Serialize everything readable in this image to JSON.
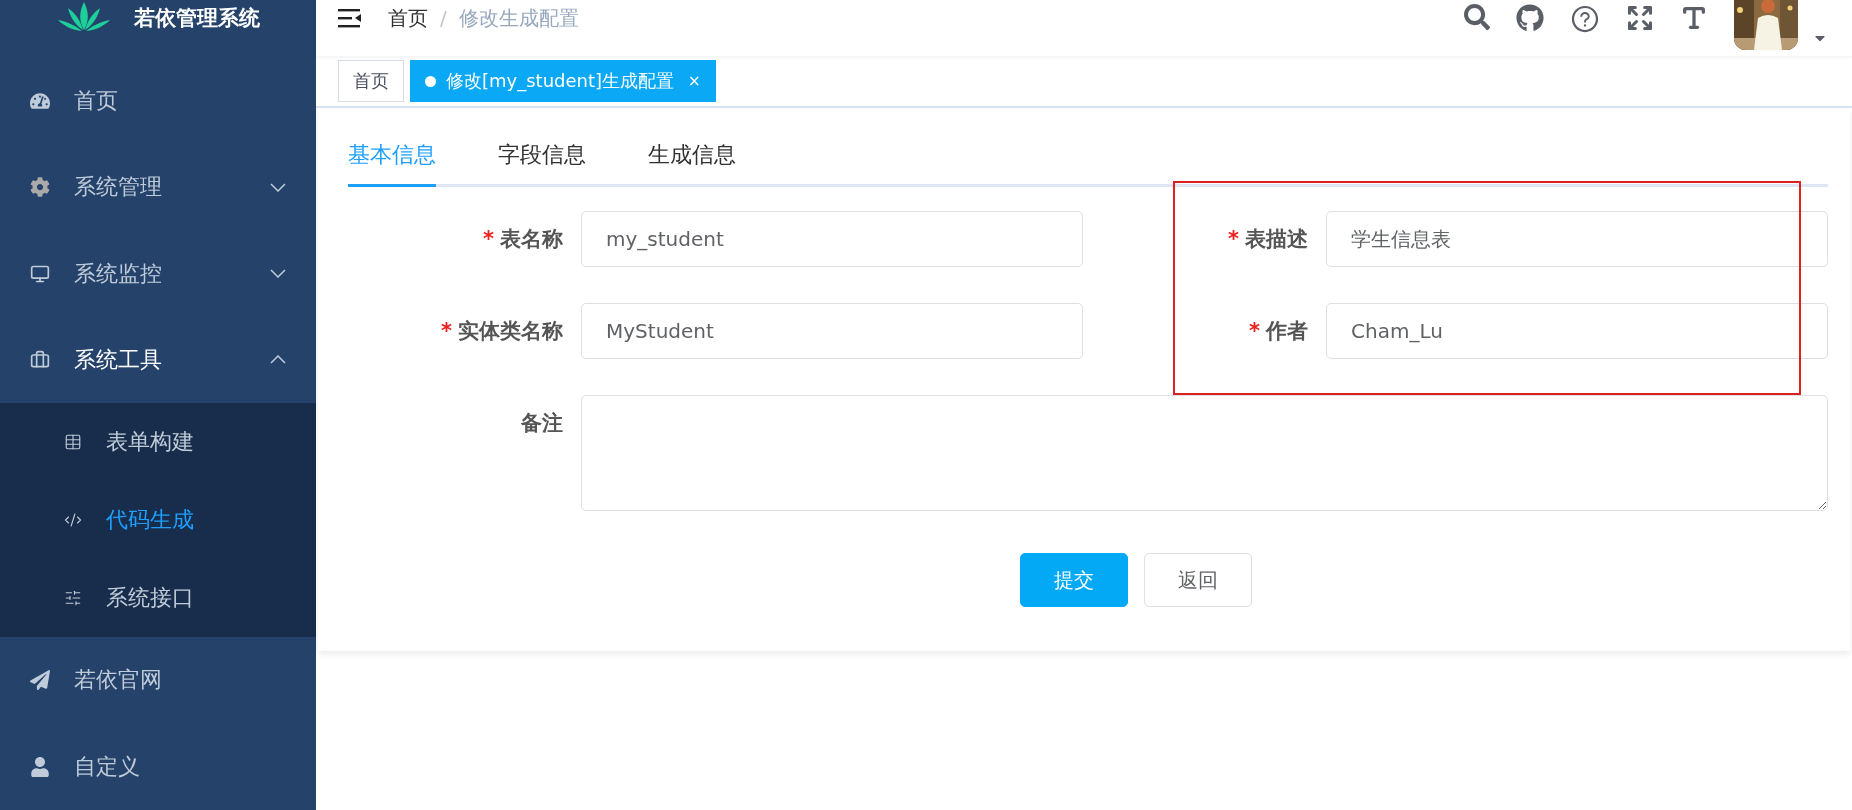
{
  "sidebar": {
    "logo_text": "若依管理系统",
    "items": [
      {
        "label": "首页",
        "selected": false
      },
      {
        "label": "系统管理",
        "selected": false,
        "expanded": false
      },
      {
        "label": "系统监控",
        "selected": false,
        "expanded": false
      },
      {
        "label": "系统工具",
        "selected": false,
        "expanded": true,
        "children": [
          {
            "label": "表单构建",
            "selected": false
          },
          {
            "label": "代码生成",
            "selected": true
          },
          {
            "label": "系统接口",
            "selected": false
          }
        ]
      },
      {
        "label": "若依官网",
        "selected": false
      },
      {
        "label": "自定义",
        "selected": false
      }
    ]
  },
  "navbar": {
    "breadcrumb": [
      {
        "label": "首页"
      },
      {
        "label": "修改生成配置"
      }
    ],
    "separator": "/"
  },
  "tags": [
    {
      "label": "首页",
      "selected": false
    },
    {
      "label": "修改[my_student]生成配置",
      "selected": true,
      "close": "×"
    }
  ],
  "tabs": [
    {
      "label": "基本信息",
      "selected": true
    },
    {
      "label": "字段信息",
      "selected": false
    },
    {
      "label": "生成信息",
      "selected": false
    }
  ],
  "form": {
    "fields": [
      {
        "kind": "input",
        "label": "表名称",
        "required": true,
        "value": "my_student"
      },
      {
        "kind": "input",
        "label": "表描述",
        "required": true,
        "value": "学生信息表"
      },
      {
        "kind": "input",
        "label": "实体类名称",
        "required": true,
        "value": "MyStudent"
      },
      {
        "kind": "input",
        "label": "作者",
        "required": true,
        "value": "Cham_Lu"
      },
      {
        "kind": "textarea",
        "label": "备注",
        "required": false
      }
    ],
    "required_mark": "*",
    "annotation": {
      "kind": "frame"
    },
    "buttons": [
      {
        "kind": "primary",
        "label": "提交"
      },
      {
        "kind": "default",
        "label": "返回"
      }
    ]
  }
}
